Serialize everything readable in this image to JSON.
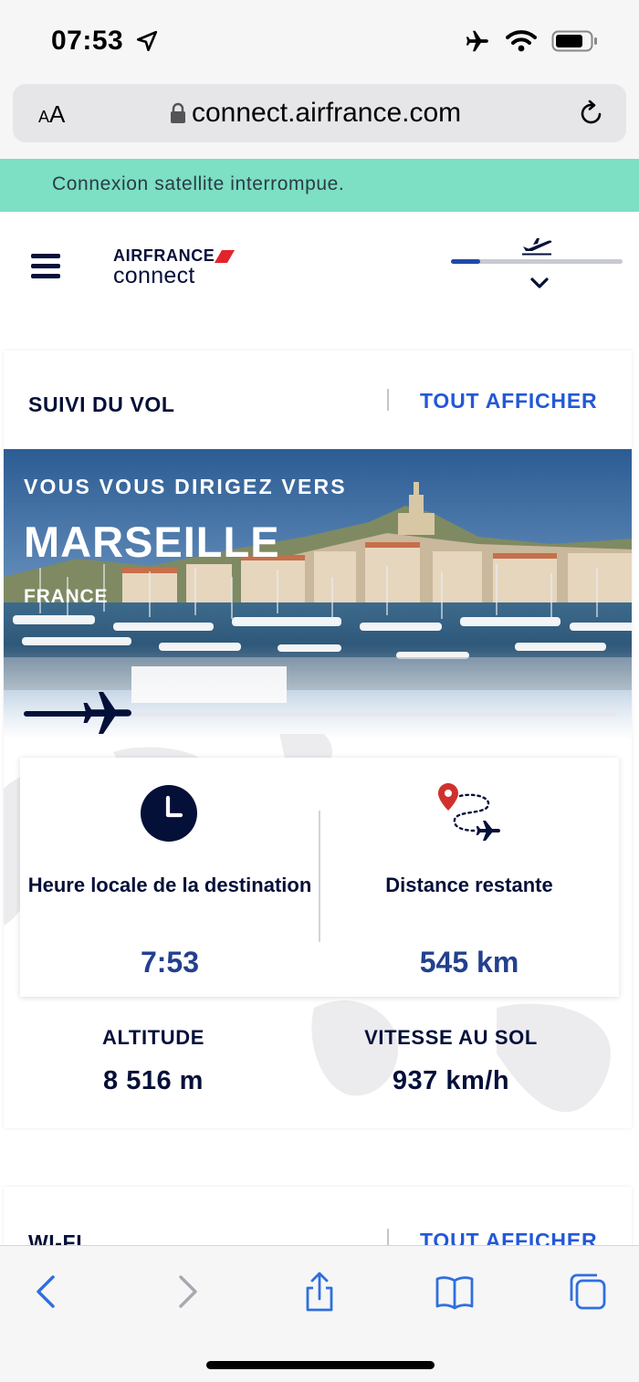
{
  "status_bar": {
    "time": "07:53",
    "icons": [
      "location-arrow-icon",
      "airplane-mode-icon",
      "wifi-icon",
      "battery-icon"
    ]
  },
  "browser": {
    "text_size_label": "AA",
    "url": "connect.airfrance.com",
    "icons": [
      "lock-icon",
      "reload-icon"
    ]
  },
  "banner": {
    "message": "Connexion satellite interrompue.",
    "color": "#7ddfc3"
  },
  "header": {
    "logo_top": "AIRFRANCE",
    "logo_bottom": "connect",
    "flight_progress": 0.17
  },
  "flight_card": {
    "title": "SUIVI DU VOL",
    "link": "TOUT AFFICHER",
    "hero": {
      "subtitle": "VOUS VOUS DIRIGEZ VERS",
      "city": "MARSEILLE",
      "country": "FRANCE",
      "progress": 0.15
    },
    "local_time": {
      "label": "Heure locale de la destination",
      "value": "7:53"
    },
    "distance": {
      "label": "Distance restante",
      "value": "545 km"
    },
    "altitude": {
      "label": "ALTITUDE",
      "value": "8 516 m"
    },
    "ground_speed": {
      "label": "VITESSE AU SOL",
      "value": "937 km/h"
    }
  },
  "wifi_card": {
    "title": "WI-FI",
    "link": "TOUT AFFICHER"
  },
  "colors": {
    "navy": "#051039",
    "link_blue": "#2458d6",
    "value_blue": "#23408e",
    "brand_red": "#e3242b",
    "pin_red": "#d0312d"
  },
  "toolbar": {
    "icons": [
      "back-icon",
      "forward-icon",
      "share-icon",
      "bookmarks-icon",
      "tabs-icon"
    ]
  }
}
